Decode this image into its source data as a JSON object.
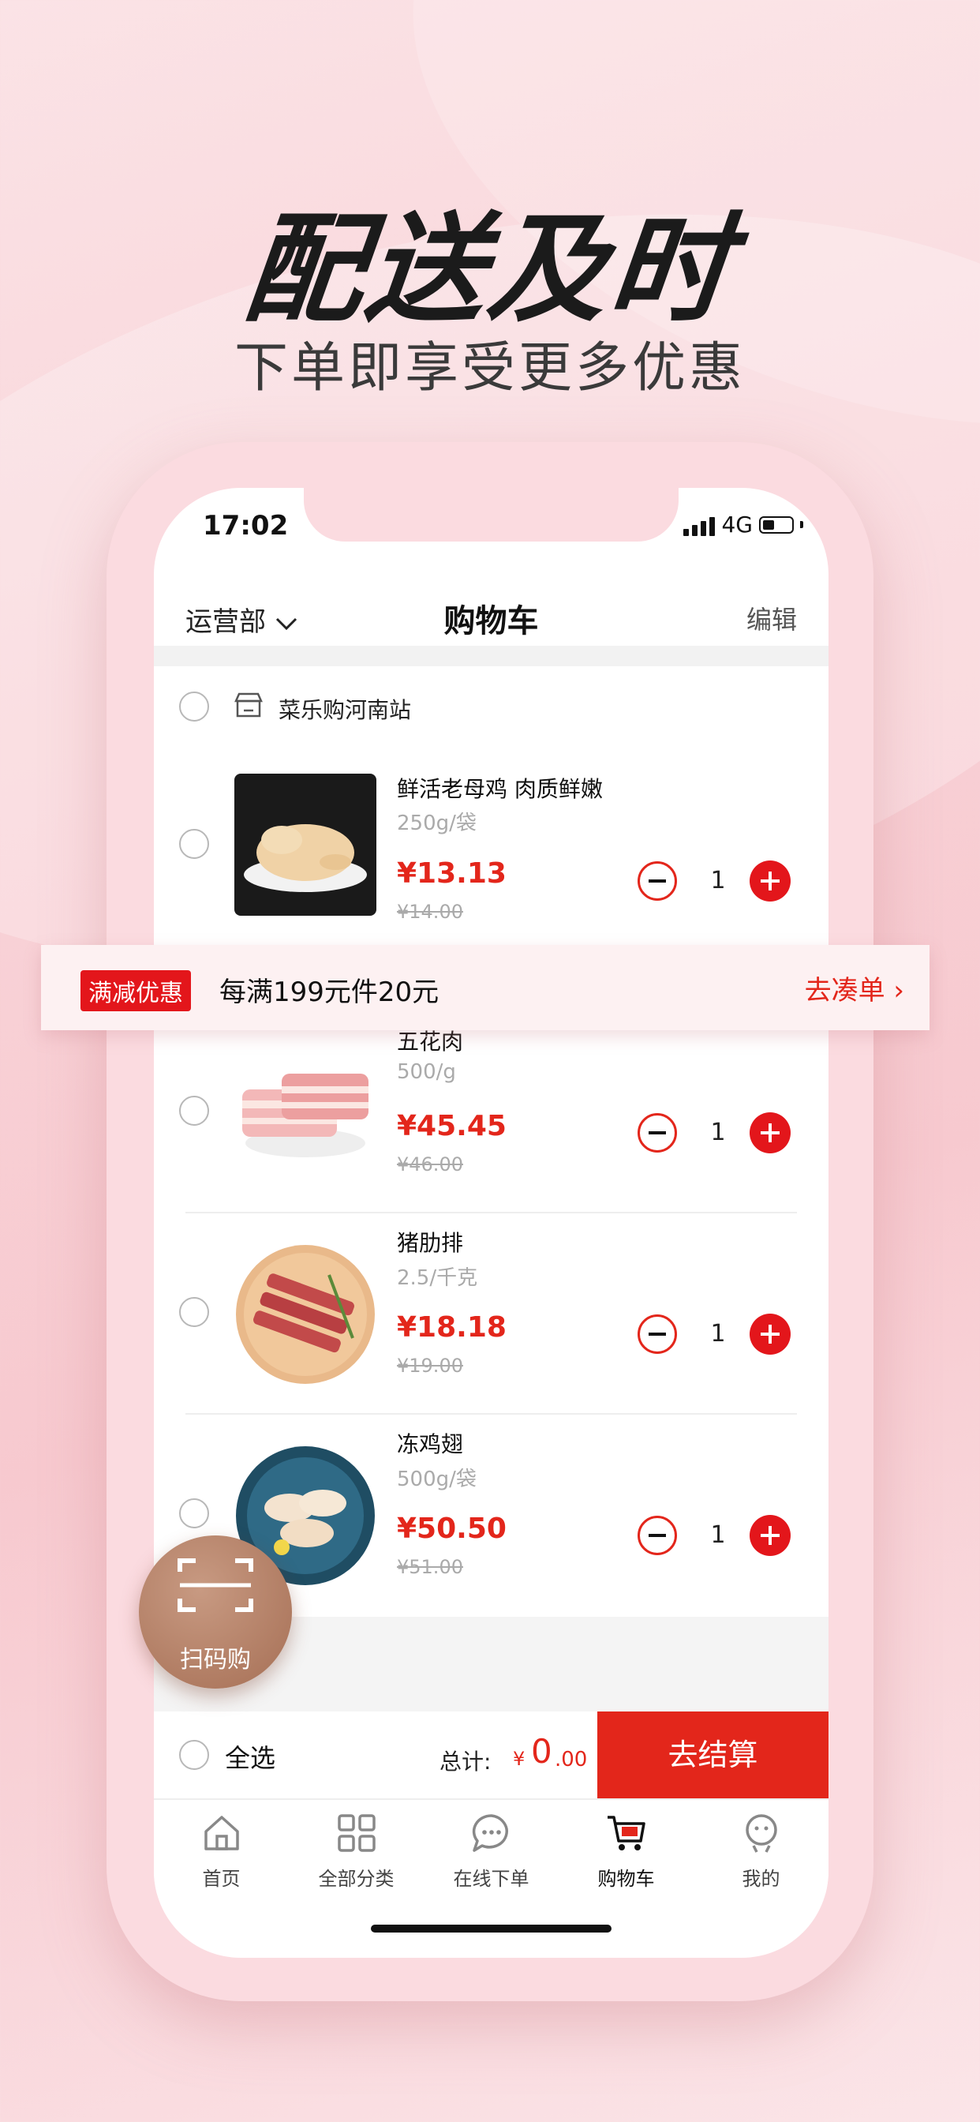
{
  "headline": "配送及时",
  "subline": "下单即享受更多优惠",
  "status": {
    "time": "17:02",
    "network": "4G"
  },
  "nav": {
    "left": "运营部",
    "title": "购物车",
    "right": "编辑"
  },
  "store": {
    "name": "菜乐购河南站"
  },
  "items": [
    {
      "name": "鲜活老母鸡 肉质鲜嫩",
      "spec": "250g/袋",
      "price": "¥13.13",
      "old_price": "¥14.00",
      "qty": "1"
    },
    {
      "name": "五花肉",
      "spec": "500/g",
      "price": "¥45.45",
      "old_price": "¥46.00",
      "qty": "1"
    },
    {
      "name": "猪肋排",
      "spec": "2.5/千克",
      "price": "¥18.18",
      "old_price": "¥19.00",
      "qty": "1"
    },
    {
      "name": "冻鸡翅",
      "spec": "500g/袋",
      "price": "¥50.50",
      "old_price": "¥51.00",
      "qty": "1"
    }
  ],
  "promo": {
    "tag": "满减优惠",
    "text": "每满199元件20元",
    "link": "去凑单 ›"
  },
  "checkout": {
    "select_all": "全选",
    "total_label": "总计:",
    "currency": "¥",
    "total_int": "0",
    "total_dec": ".00",
    "button": "去结算"
  },
  "scan": {
    "label": "扫码购"
  },
  "tabs": [
    {
      "label": "首页",
      "icon": "home-icon"
    },
    {
      "label": "全部分类",
      "icon": "grid-icon"
    },
    {
      "label": "在线下单",
      "icon": "chat-icon"
    },
    {
      "label": "购物车",
      "icon": "cart-icon"
    },
    {
      "label": "我的",
      "icon": "profile-icon"
    }
  ],
  "colors": {
    "accent": "#e3261b",
    "background": "#f8d2d7",
    "scan": "#b27a60"
  }
}
